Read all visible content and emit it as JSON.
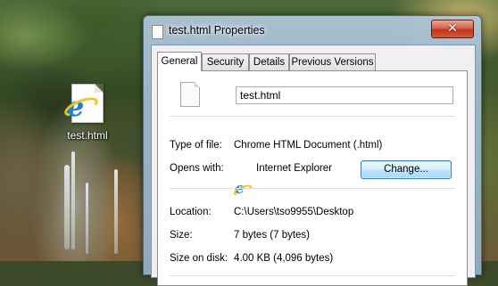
{
  "desktop": {
    "icon_label": "test.html"
  },
  "window": {
    "title": "test.html Properties",
    "close_glyph": "✕"
  },
  "tabs": [
    {
      "label": "General",
      "active": true
    },
    {
      "label": "Security",
      "active": false
    },
    {
      "label": "Details",
      "active": false
    },
    {
      "label": "Previous Versions",
      "active": false
    }
  ],
  "general": {
    "file_name": "test.html",
    "type_label": "Type of file:",
    "type_value": "Chrome HTML Document (.html)",
    "opens_label": "Opens with:",
    "opens_value": "Internet Explorer",
    "change_button": "Change...",
    "location_label": "Location:",
    "location_value": "C:\\Users\\tso9955\\Desktop",
    "size_label": "Size:",
    "size_value": "7 bytes (7 bytes)",
    "size_on_disk_label": "Size on disk:",
    "size_on_disk_value": "4.00 KB (4,096 bytes)"
  },
  "icons": {
    "ie_glyph": "e",
    "desktop_icon": "ie-html-file-icon",
    "title_icon": "document-icon",
    "file_icon": "blank-document-icon",
    "opens_icon": "internet-explorer-icon"
  },
  "colors": {
    "close_button": "#c1341c",
    "ie_blue": "#1e7fd8",
    "ie_ring": "#f2c318",
    "button_focus": "#3c7fb1"
  }
}
